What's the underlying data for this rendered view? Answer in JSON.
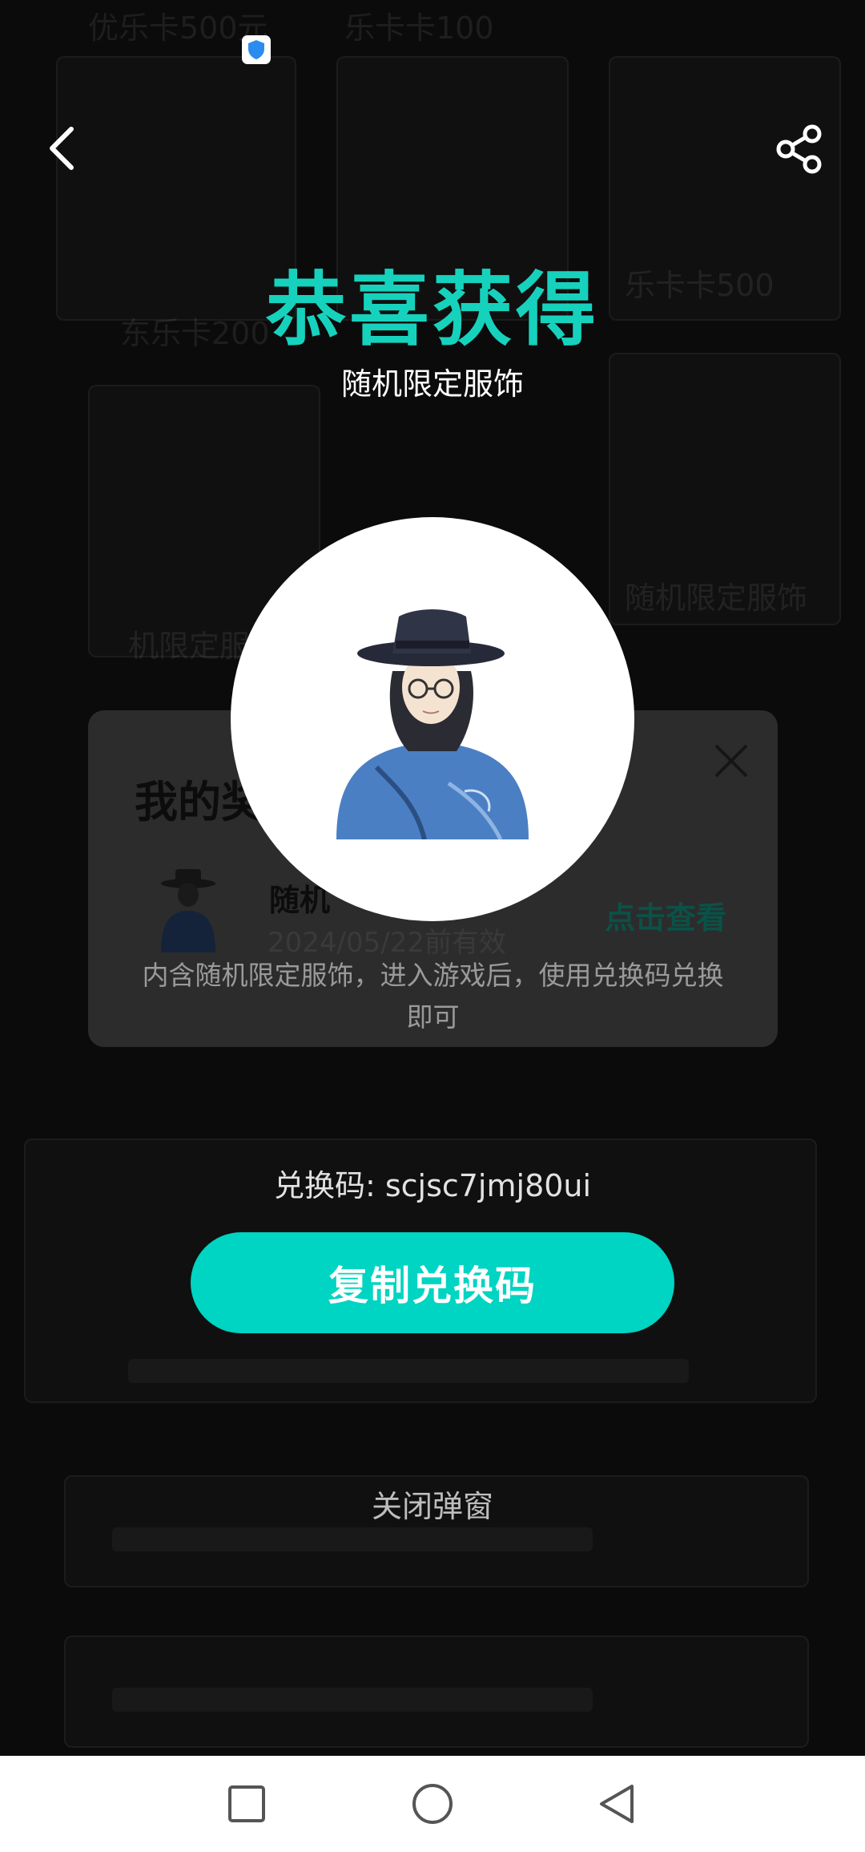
{
  "background": {
    "texts": [
      "优乐卡500元",
      "乐卡卡100",
      "东乐卡200",
      "乐卡卡500",
      "机限定服饰",
      "随机限定服饰"
    ]
  },
  "header": {
    "back_icon": "chevron-left-icon",
    "share_icon": "share-icon"
  },
  "popup": {
    "title": "恭喜获得",
    "subtitle": "随机限定服饰",
    "code_line": "兑换码: scjsc7jmj80ui",
    "copy_button_label": "复制兑换码",
    "close_label": "关闭弹窗"
  },
  "sheet": {
    "title": "我的奖",
    "item_title": "随机",
    "item_date": "2024/05/22前有效",
    "view_link": "点击查看",
    "description": "内含随机限定服饰，进入游戏后，使用兑换码兑换即可"
  },
  "colors": {
    "accent": "#16d2bd",
    "button": "#00d4c2"
  },
  "nav": {
    "recent_icon": "square-icon",
    "home_icon": "circle-icon",
    "back_icon": "triangle-back-icon"
  }
}
